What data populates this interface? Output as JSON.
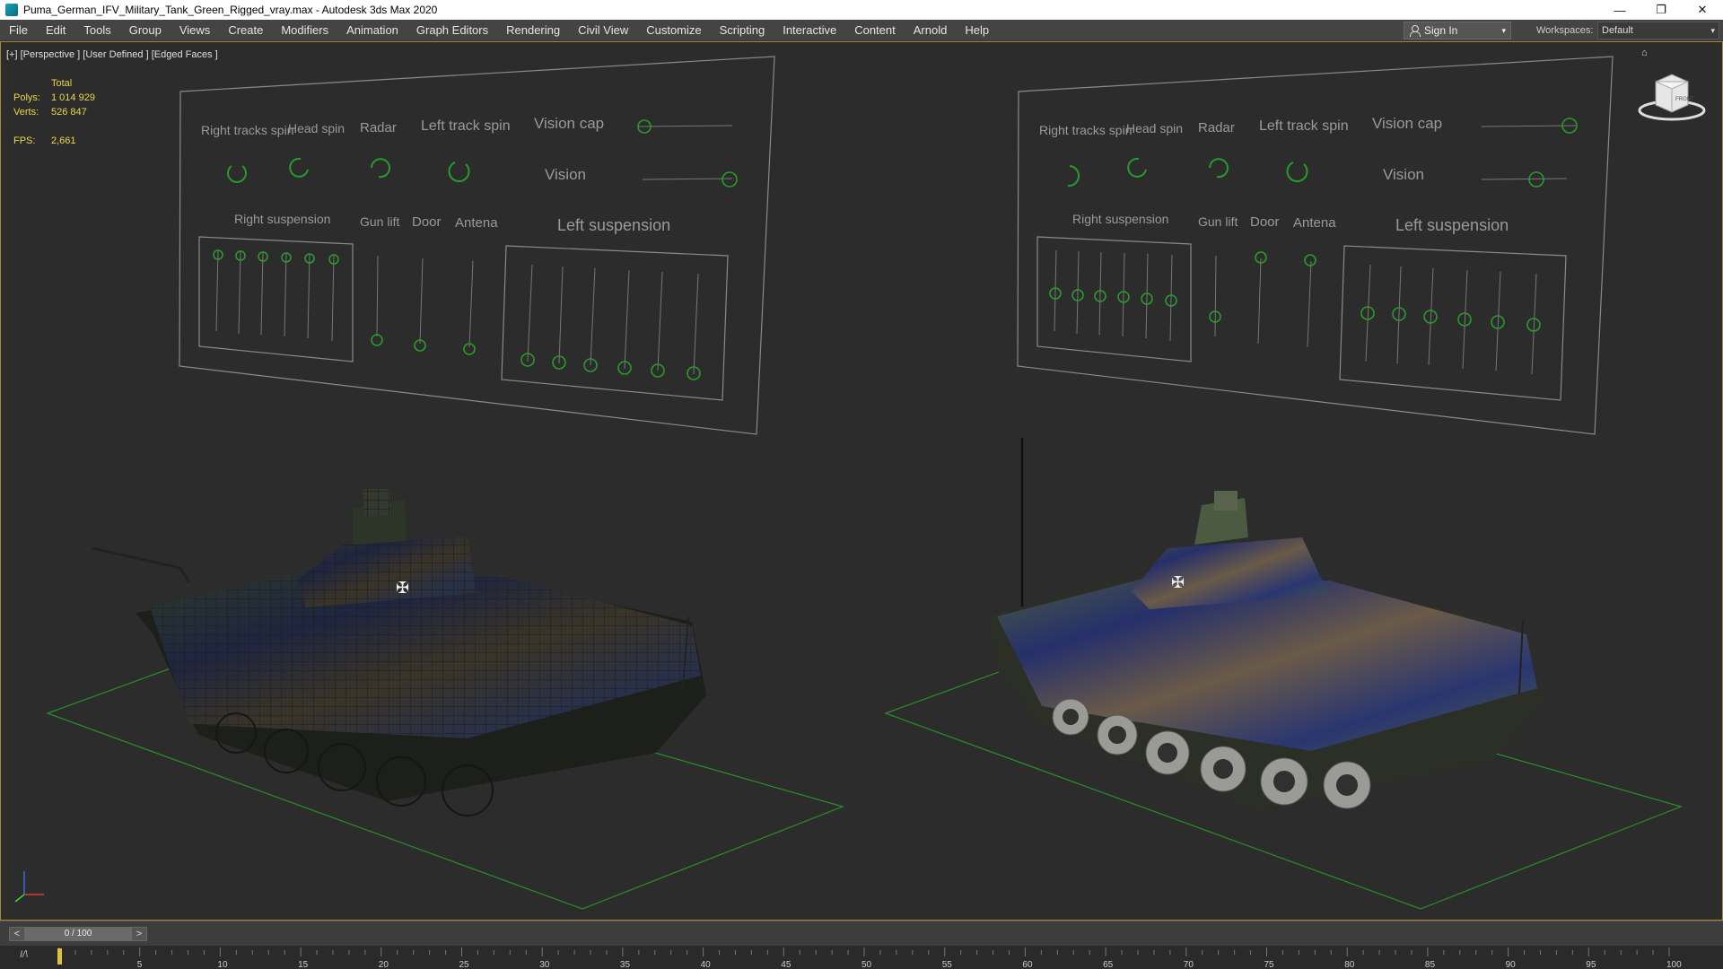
{
  "window": {
    "title": "Puma_German_IFV_Military_Tank_Green_Rigged_vray.max - Autodesk 3ds Max 2020",
    "minimize": "—",
    "restore": "❐",
    "close": "✕"
  },
  "menu": [
    "File",
    "Edit",
    "Tools",
    "Group",
    "Views",
    "Create",
    "Modifiers",
    "Animation",
    "Graph Editors",
    "Rendering",
    "Civil View",
    "Customize",
    "Scripting",
    "Interactive",
    "Content",
    "Arnold",
    "Help"
  ],
  "signin": {
    "label": "Sign In",
    "caret": "▾"
  },
  "workspace": {
    "label": "Workspaces:",
    "value": "Default",
    "caret": "▾"
  },
  "viewport": {
    "label": "[+] [Perspective ] [User Defined ] [Edged Faces ]",
    "stats": {
      "total": "Total",
      "polys_k": "Polys:",
      "polys": "1 014 929",
      "verts_k": "Verts:",
      "verts": "526 847",
      "fps_k": "FPS:",
      "fps": "2,661"
    },
    "home": "⌂",
    "navcube_label": "FRONT"
  },
  "panel_left": {
    "right_tracks_spin": "Right tracks spin",
    "head_spin": "Head spin",
    "radar": "Radar",
    "left_track_spin": "Left track spin",
    "vision_cap": "Vision cap",
    "vision": "Vision",
    "right_suspension": "Right suspension",
    "gun_lift": "Gun lift",
    "door": "Door",
    "antena": "Antena",
    "left_suspension": "Left suspension"
  },
  "panel_right": {
    "right_tracks_spin": "Right tracks spin",
    "head_spin": "Head spin",
    "radar": "Radar",
    "left_track_spin": "Left track spin",
    "vision_cap": "Vision cap",
    "vision": "Vision",
    "right_suspension": "Right suspension",
    "gun_lift": "Gun lift",
    "door": "Door",
    "antena": "Antena",
    "left_suspension": "Left suspension"
  },
  "timeline": {
    "prev": "<",
    "next": ">",
    "frame": "0 / 100",
    "track_icon": "I/\\",
    "ticks": [
      "5",
      "10",
      "15",
      "20",
      "25",
      "30",
      "35",
      "40",
      "45",
      "50",
      "55",
      "60",
      "65",
      "70",
      "75",
      "80",
      "85",
      "90",
      "95",
      "100"
    ],
    "min": 0,
    "max": 100,
    "current": 0
  }
}
